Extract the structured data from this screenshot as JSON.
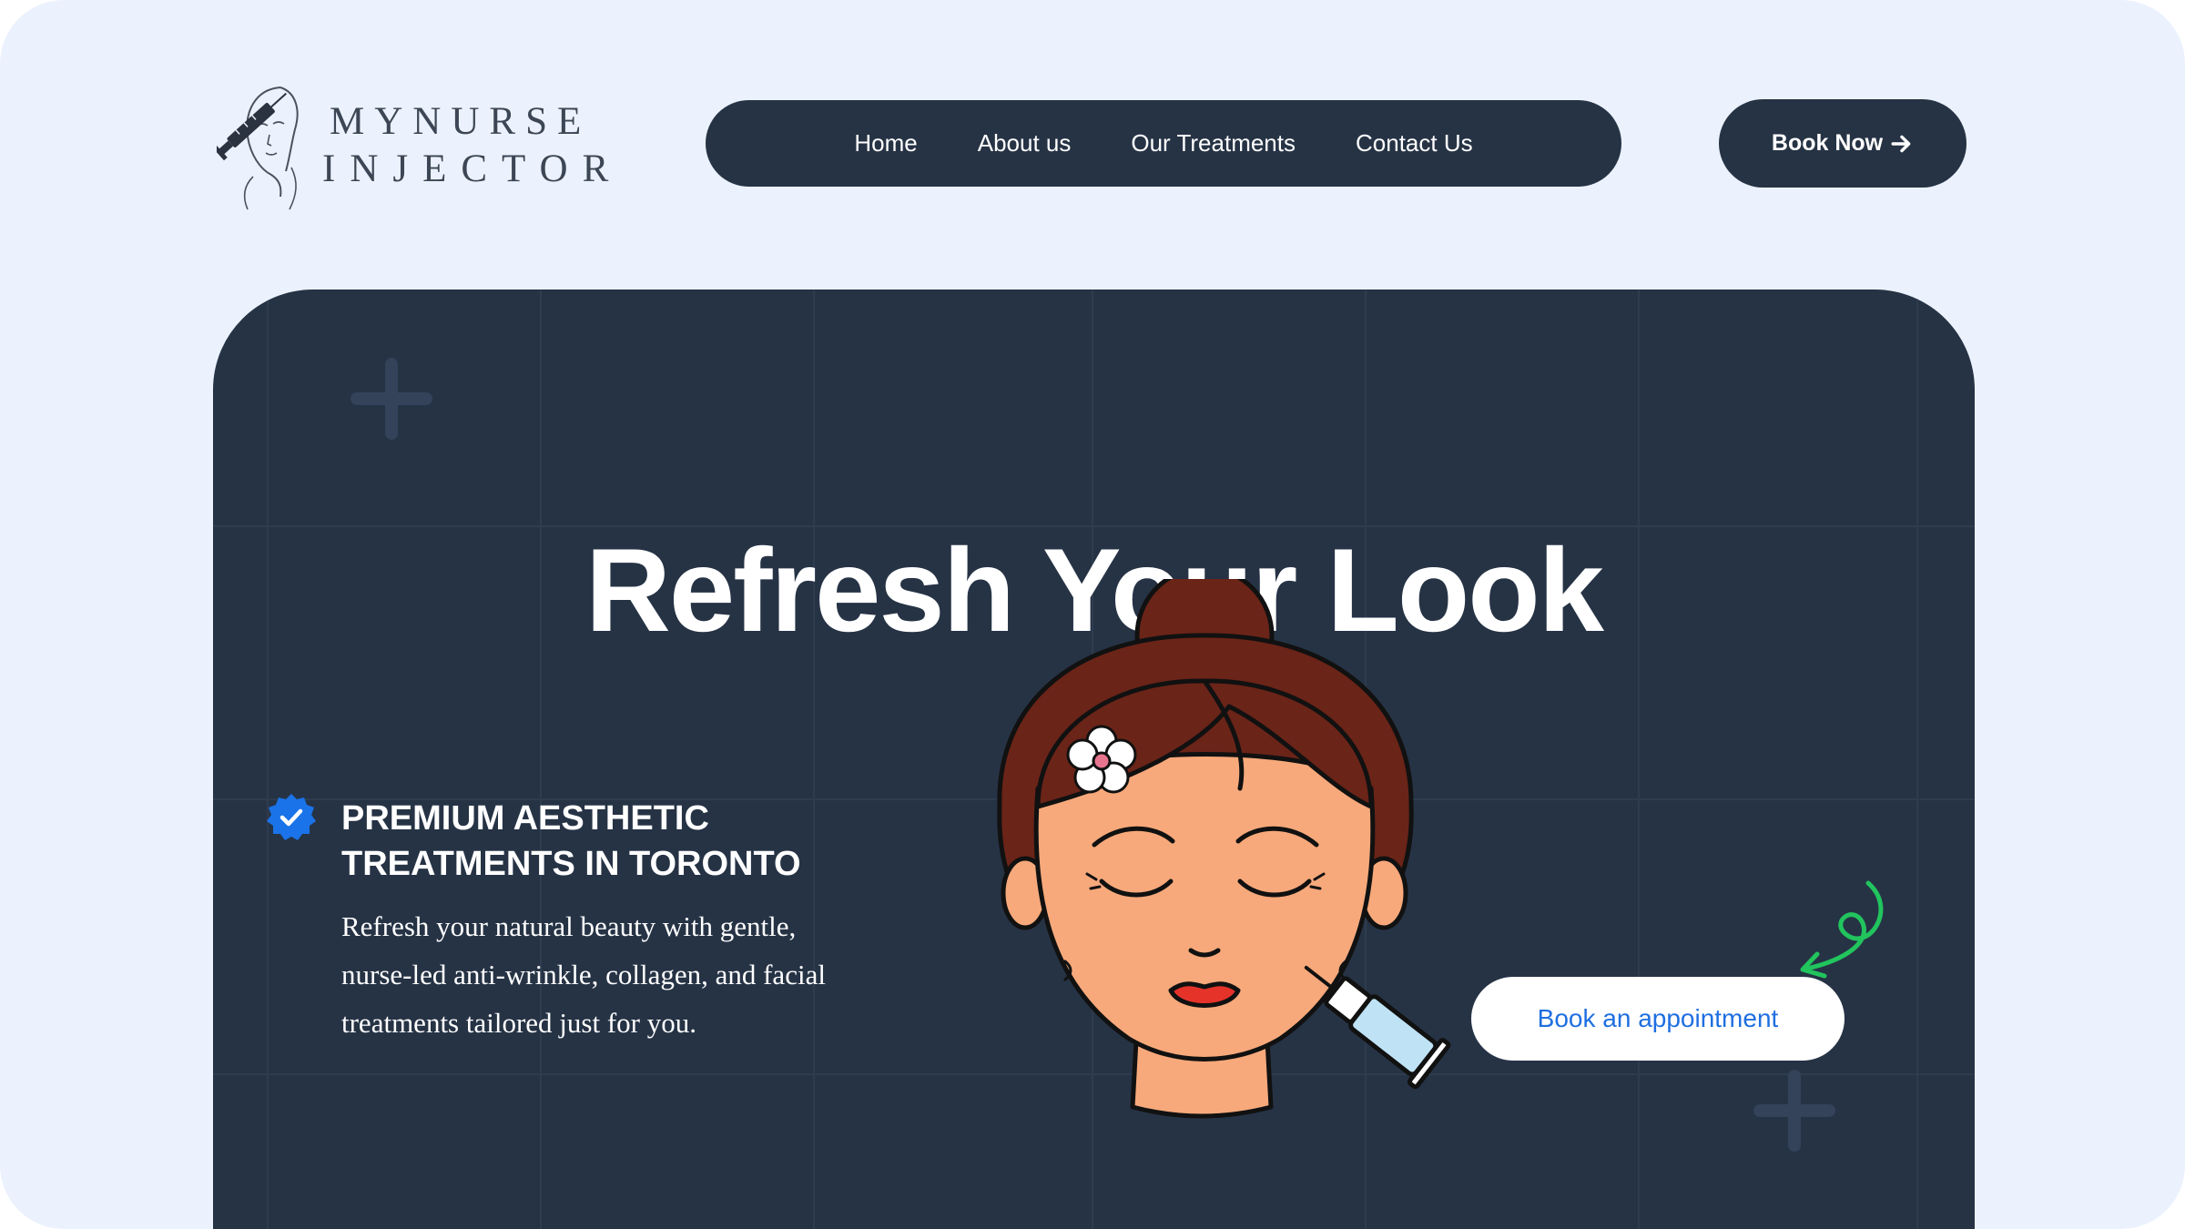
{
  "brand": {
    "line1": "MYNURSE",
    "line2": "INJECTOR",
    "logo_icon": "syringe-face-icon"
  },
  "nav": {
    "items": [
      {
        "label": "Home"
      },
      {
        "label": "About us"
      },
      {
        "label": "Our Treatments"
      },
      {
        "label": "Contact Us"
      }
    ]
  },
  "header": {
    "book_now_label": "Book Now",
    "book_now_icon": "arrow-right-icon"
  },
  "hero": {
    "title": "Refresh Your Look",
    "subtitle": "PREMIUM AESTHETIC TREATMENTS IN TORONTO",
    "description": "Refresh your natural beauty with gentle, nurse-led anti-wrinkle, collagen, and facial treatments tailored just for you.",
    "badge_icon": "verified-check-icon",
    "illustration": "woman-face-injection-illustration",
    "cta_label": "Book an appointment",
    "cta_arrow_icon": "curly-arrow-icon"
  },
  "colors": {
    "page_bg": "#ebf2fd",
    "dark": "#263345",
    "accent_blue": "#1f6fe0",
    "badge_blue": "#1a73e8",
    "arrow_green": "#21c45d"
  }
}
